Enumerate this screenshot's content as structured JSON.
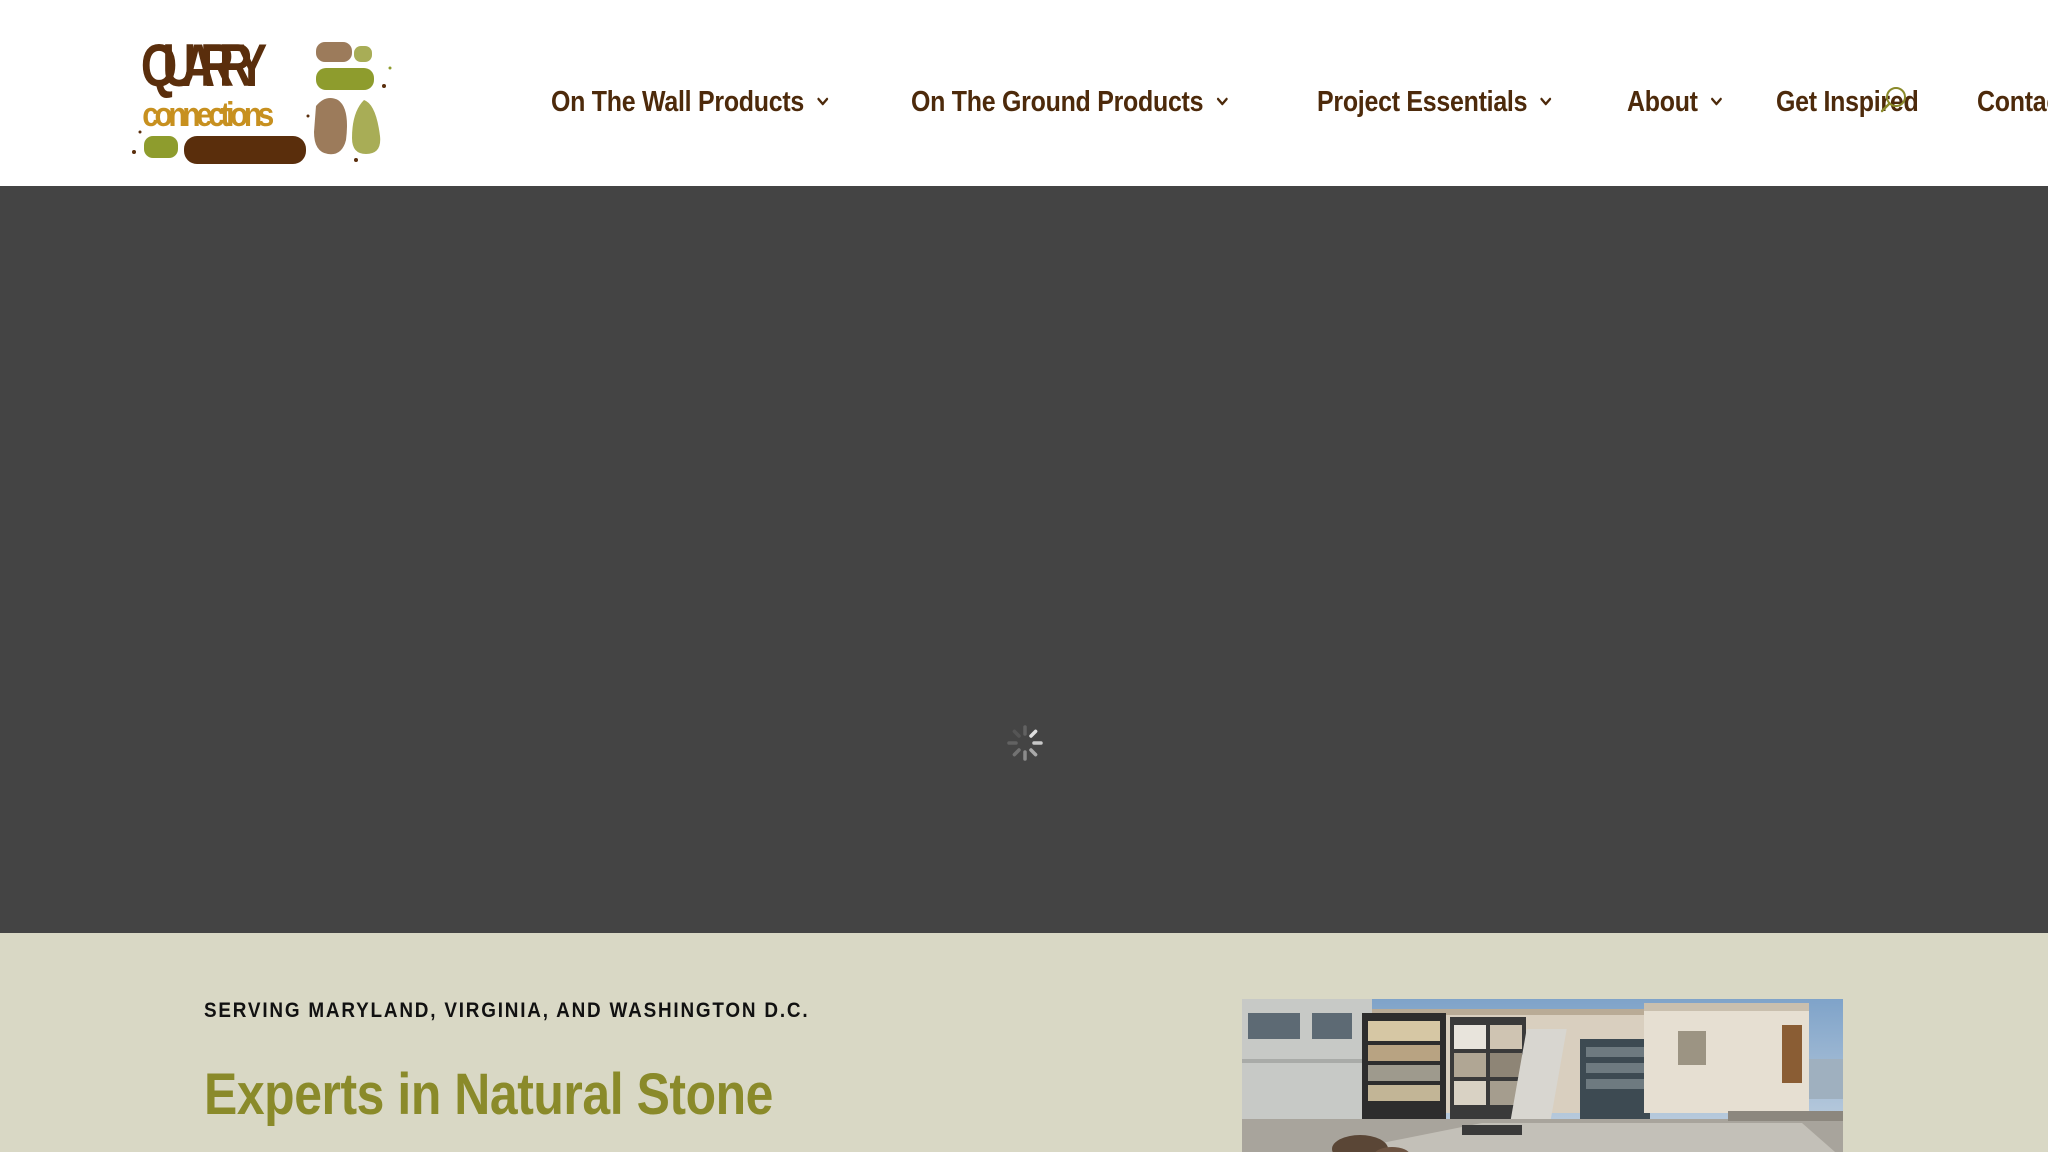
{
  "site": {
    "logo": {
      "line1": "QUARRY",
      "line2": "connections",
      "colors": {
        "brown": "#5a2e0c",
        "gold": "#c7901f",
        "olive": "#8e9c2d",
        "tan": "#9c7b5b",
        "sage": "#a8ad56"
      }
    }
  },
  "nav": {
    "items": [
      {
        "label": "On The Wall Products",
        "has_dropdown": true
      },
      {
        "label": "On The Ground Products",
        "has_dropdown": true
      },
      {
        "label": "Project Essentials",
        "has_dropdown": true
      },
      {
        "label": "About",
        "has_dropdown": true
      },
      {
        "label": "Get Inspired",
        "has_dropdown": false
      },
      {
        "label": "Contact",
        "has_dropdown": false
      }
    ],
    "search_icon": "search-icon",
    "text_color": "#4d2a0b"
  },
  "hero": {
    "background_color": "#444444",
    "state": "loading",
    "icon": "loading-spinner-icon"
  },
  "intro": {
    "background_color": "#d9d8c5",
    "eyebrow": "SERVING MARYLAND, VIRGINIA, AND WASHINGTON D.C.",
    "headline": "Experts in Natural Stone",
    "headline_color": "#8a8a2a"
  }
}
